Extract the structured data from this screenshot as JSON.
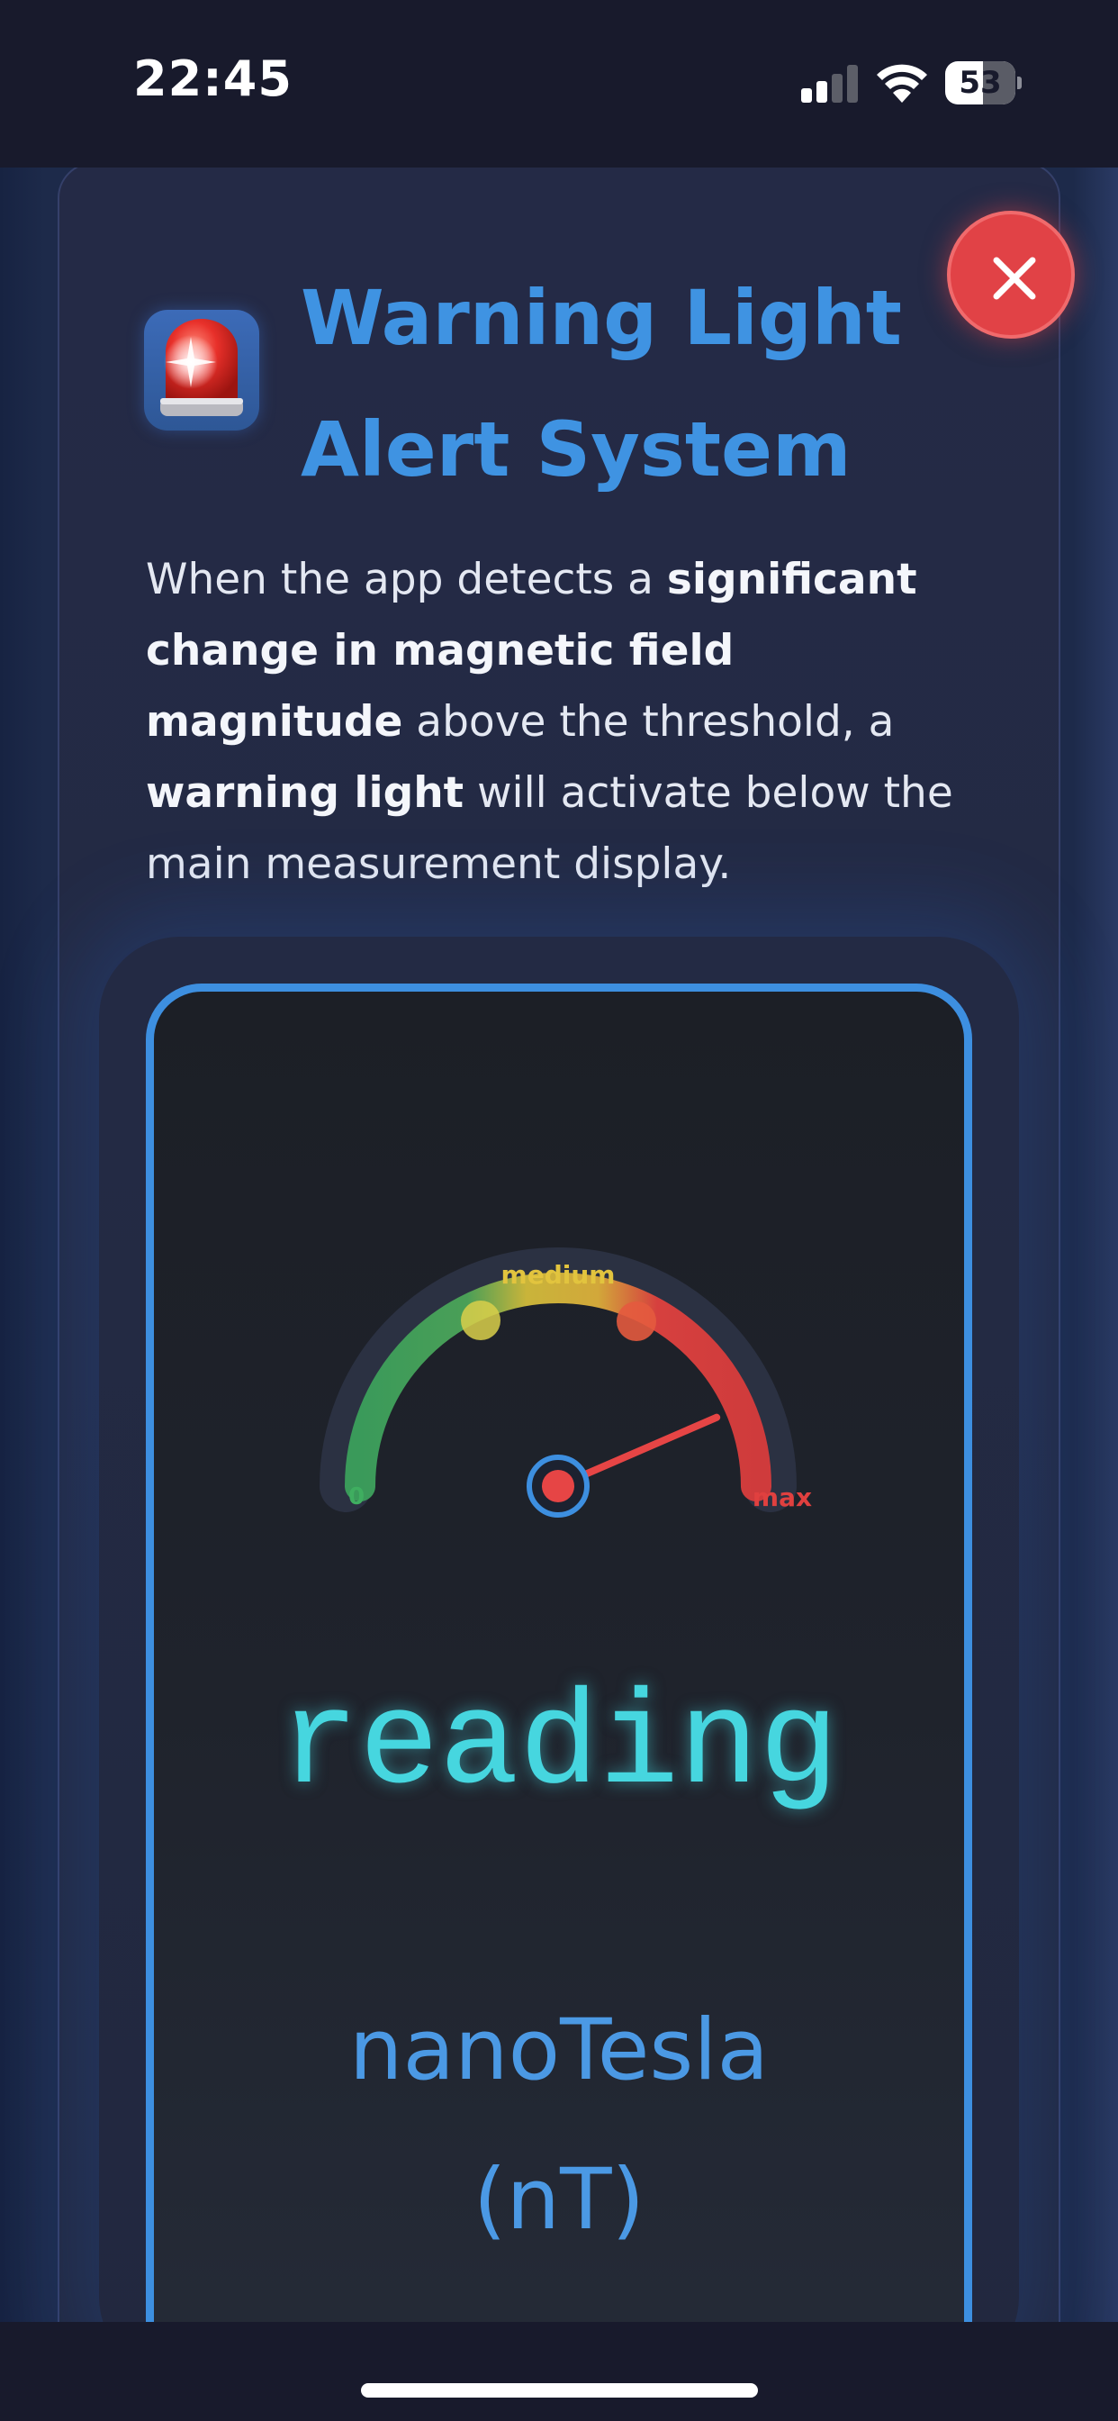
{
  "status_bar": {
    "time": "22:45",
    "battery_level": "53",
    "signal_bars_active": 2,
    "signal_bars_total": 4,
    "icons": [
      "signal-icon",
      "wifi-icon",
      "battery-icon"
    ]
  },
  "modal": {
    "title_line1": "Warning Light",
    "title_line2": "Alert System",
    "icon": "rotating-light-siren-icon",
    "close_icon": "close-icon",
    "description": {
      "part1": "When the app detects a ",
      "bold1": "significant change in magnetic field magnitude",
      "part2": " above the threshold, a ",
      "bold2": "warning light",
      "part3": " will activate below the main measurement display."
    }
  },
  "demo_display": {
    "gauge": {
      "min_label": "0",
      "mid_label": "medium",
      "max_label": "max",
      "needle_fraction": 0.87,
      "zones": [
        {
          "name": "low",
          "color": "#3a9a5a"
        },
        {
          "name": "medium",
          "color": "#c9b43a"
        },
        {
          "name": "high",
          "color": "#d6403e"
        }
      ]
    },
    "reading": "reading",
    "unit_line1": "nanoTesla",
    "unit_line2": "(nT)"
  },
  "colors": {
    "accent_blue": "#3f93e2",
    "close_red": "#e14246",
    "reading_cyan": "#46d6df",
    "background": "#181a2c"
  }
}
